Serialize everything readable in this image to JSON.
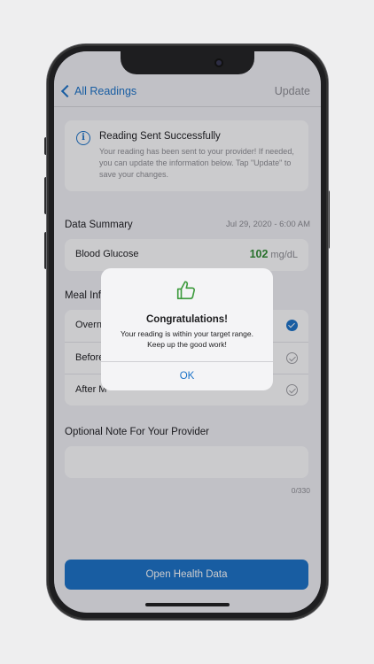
{
  "nav": {
    "back_label": "All Readings",
    "update_label": "Update"
  },
  "info": {
    "icon": "info-icon",
    "title": "Reading Sent Successfully",
    "body": "Your reading has been sent to your provider! If needed, you can update the information below. Tap \"Update\" to save your changes."
  },
  "summary": {
    "title": "Data Summary",
    "date": "Jul 29, 2020 - 6:00 AM",
    "label": "Blood Glucose",
    "value": "102",
    "unit": "mg/dL"
  },
  "meal": {
    "title_visible": "Meal Inf",
    "rows": [
      {
        "label": "Overn",
        "checked": true
      },
      {
        "label": "Before",
        "checked": false
      },
      {
        "label": "After M",
        "checked": false
      }
    ]
  },
  "note": {
    "title": "Optional Note For Your Provider",
    "value": "",
    "counter": "0/330"
  },
  "cta": {
    "label": "Open Health Data"
  },
  "alert": {
    "icon": "thumbs-up-icon",
    "title": "Congratulations!",
    "message_line1": "Your reading is within your target range.",
    "message_line2": "Keep up the good work!",
    "ok_label": "OK"
  },
  "colors": {
    "accent": "#1a72c8",
    "glucose_in_range": "#2f8c31",
    "thumbs_up": "#3c9a3c"
  }
}
